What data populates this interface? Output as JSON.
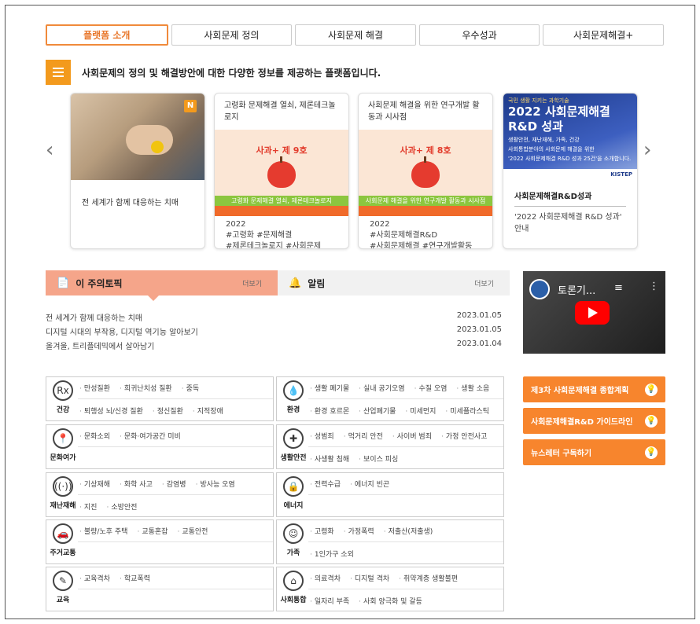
{
  "tabs": [
    "플랫폼 소개",
    "사회문제 정의",
    "사회문제 해결",
    "우수성과",
    "사회문제해결+"
  ],
  "intro": "사회문제의 정의 및 해결방안에 대한 다양한 정보를 제공하는 플랫폼입니다.",
  "carousel": {
    "prev": "‹",
    "next": "›",
    "card1": {
      "badge": "N",
      "caption": "전 세계가 함께 대응하는 치매"
    },
    "card2": {
      "title": "고령화 문제해결 열쇠, 제론테크놀로지",
      "poster_title": "사과+ 제 9호",
      "band_text": "고령화 문제해결 열쇠, 제론테크놀로지",
      "year": "2022",
      "tags1": "#고령화 #문제해결",
      "tags2": "#제론테크놀로지 #사회문제"
    },
    "card3": {
      "title": "사회문제 해결을 위한 연구개발 활동과 시사점",
      "poster_title": "사과+ 제 8호",
      "band_text": "사회문제 해결을 위한 연구개발 활동과 시사점",
      "year": "2022",
      "tags1": "#사회문제해결R&D",
      "tags2": "#사회문제해결 #연구개발활동"
    },
    "card4": {
      "small": "국민 생활 지키는 과학기술",
      "big1": "2022 사회문제해결",
      "big2": "R&D 성과",
      "sub1": "생활안전, 재난재해, 가족, 건강",
      "sub2": "사회통합분야의 사회문제 해결을 위한",
      "sub3": "'2022 사회문제해결 R&D 성과 25건'을 소개합니다.",
      "logo": "KISTEP",
      "title": "사회문제해결R&D성과",
      "desc": "'2022 사회문제해결 R&D 성과' 안내"
    }
  },
  "news": {
    "tab1": {
      "icon": "📄",
      "title": "이 주의토픽",
      "more": "더보기"
    },
    "tab2": {
      "icon": "🔔",
      "title": "알림",
      "more": "더보기"
    },
    "rows": [
      {
        "title": "전 세계가 함께 대응하는 치매",
        "date": "2023.01.05"
      },
      {
        "title": "디지털 시대의 부작용, 디지털 역기능 알아보기",
        "date": "2023.01.05"
      },
      {
        "title": "올겨울, 트리플데믹에서 살아남기",
        "date": "2023.01.04"
      }
    ]
  },
  "video": {
    "title": "토론기...",
    "menu": "≡",
    "dots": "⋮"
  },
  "side_buttons": [
    {
      "label": "제3차 사회문제해결 종합계획",
      "icon": "💡"
    },
    {
      "label": "사회문제해결R&D 가이드라인",
      "icon": "💡"
    },
    {
      "label": "뉴스레터 구독하기",
      "icon": "💡"
    }
  ],
  "categories": [
    {
      "label": "건강",
      "icon": "Rx",
      "row1": [
        "만성질환",
        "희귀난치성 질환",
        "중독"
      ],
      "row2": [
        "퇴행성 뇌/신경 질환",
        "정신질환",
        "지적장애"
      ]
    },
    {
      "label": "환경",
      "icon": "💧",
      "row1": [
        "생활 폐기물",
        "실내 공기오염",
        "수질 오염",
        "생활 소음"
      ],
      "row2": [
        "환경 호르몬",
        "산업폐기물",
        "미세먼지",
        "미세플라스틱"
      ]
    },
    {
      "label": "문화여가",
      "icon": "📍",
      "row1": [
        "문화소외",
        "문화·여가공간 미비"
      ],
      "row2": []
    },
    {
      "label": "생활안전",
      "icon": "✚",
      "row1": [
        "성범죄",
        "먹거리 안전",
        "사이버 범죄",
        "가정 안전사고"
      ],
      "row2": [
        "사생활 침해",
        "보이스 피싱"
      ]
    },
    {
      "label": "재난재해",
      "icon": "((·))",
      "row1": [
        "기상재해",
        "화학 사고",
        "감염병",
        "방사능 오염"
      ],
      "row2": [
        "지진",
        "소방안전"
      ]
    },
    {
      "label": "에너지",
      "icon": "🔒",
      "row1": [
        "전력수급",
        "에너지 빈곤"
      ],
      "row2": []
    },
    {
      "label": "주거교통",
      "icon": "🚗",
      "row1": [
        "불량/노후 주택",
        "교통혼잡",
        "교통안전"
      ],
      "row2": []
    },
    {
      "label": "가족",
      "icon": "☺",
      "row1": [
        "고령화",
        "가정폭력",
        "저출산(저출생)"
      ],
      "row2": [
        "1인가구 소외"
      ]
    },
    {
      "label": "교육",
      "icon": "✎",
      "row1": [
        "교육격차",
        "학교폭력"
      ],
      "row2": []
    },
    {
      "label": "사회통합",
      "icon": "⌂",
      "row1": [
        "의료격차",
        "디지털 격차",
        "취약계층 생활불편"
      ],
      "row2": [
        "일자리 부족",
        "사회 양극화 및 갈등"
      ]
    }
  ]
}
